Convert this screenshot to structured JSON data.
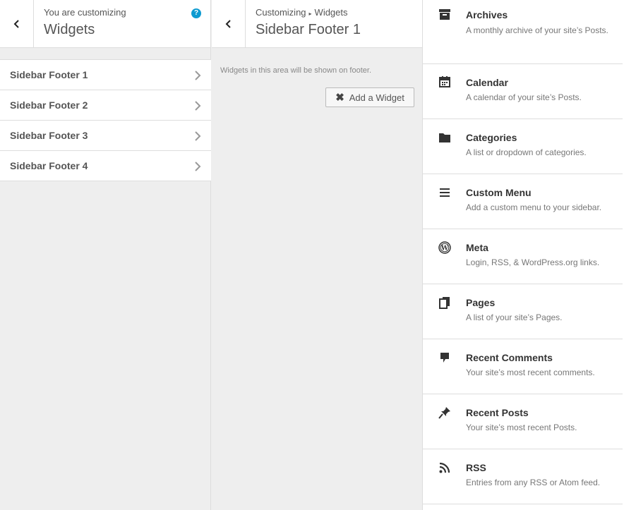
{
  "panel1": {
    "subtitle": "You are customizing",
    "title": "Widgets",
    "help_label": "?",
    "items": [
      {
        "label": "Sidebar Footer 1"
      },
      {
        "label": "Sidebar Footer 2"
      },
      {
        "label": "Sidebar Footer 3"
      },
      {
        "label": "Sidebar Footer 4"
      }
    ]
  },
  "panel2": {
    "breadcrumb_root": "Customizing",
    "breadcrumb_sep": "▸",
    "breadcrumb_leaf": "Widgets",
    "title": "Sidebar Footer 1",
    "description": "Widgets in this area will be shown on footer.",
    "add_button_label": "Add a Widget",
    "add_button_icon": "✖"
  },
  "widgets": [
    {
      "name": "Archives",
      "icon": "archive-icon",
      "desc": "A monthly archive of your site’s Posts."
    },
    {
      "name": "Calendar",
      "icon": "calendar-icon",
      "desc": "A calendar of your site’s Posts."
    },
    {
      "name": "Categories",
      "icon": "folder-icon",
      "desc": "A list or dropdown of categories."
    },
    {
      "name": "Custom Menu",
      "icon": "menu-icon",
      "desc": "Add a custom menu to your sidebar."
    },
    {
      "name": "Meta",
      "icon": "wordpress-icon",
      "desc": "Login, RSS, & WordPress.org links."
    },
    {
      "name": "Pages",
      "icon": "pages-icon",
      "desc": "A list of your site’s Pages."
    },
    {
      "name": "Recent Comments",
      "icon": "comment-icon",
      "desc": "Your site’s most recent comments."
    },
    {
      "name": "Recent Posts",
      "icon": "pin-icon",
      "desc": "Your site’s most recent Posts."
    },
    {
      "name": "RSS",
      "icon": "rss-icon",
      "desc": "Entries from any RSS or Atom feed."
    }
  ],
  "colors": {
    "accent": "#0e9bd1",
    "panel_bg": "#eeeeee",
    "border": "#dddddd"
  }
}
